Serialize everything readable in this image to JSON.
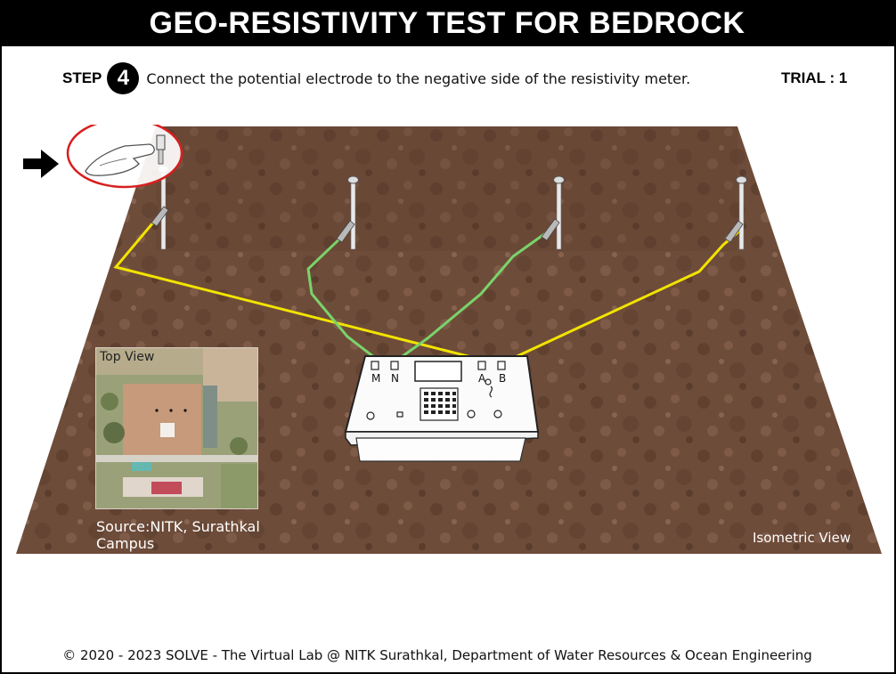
{
  "header": {
    "title": "GEO-RESISTIVITY TEST FOR BEDROCK"
  },
  "instruction": {
    "step_label": "STEP",
    "step_number": "4",
    "text": "Connect the potential electrode to the negative side of the resistivity meter."
  },
  "trial": {
    "label": "TRIAL : 1"
  },
  "meter": {
    "terminal_m": "M",
    "terminal_n": "N",
    "terminal_a": "A",
    "terminal_b": "B"
  },
  "top_view": {
    "label": "Top View"
  },
  "source": {
    "text": "Source:NITK, Surathkal Campus"
  },
  "view_label": {
    "text": "Isometric View"
  },
  "footer": {
    "text": "© 2020 - 2023 SOLVE - The Virtual Lab @ NITK Surathkal, Department of Water Resources & Ocean Engineering"
  },
  "colors": {
    "soil": "#6b4a38",
    "current_wire": "#f2e400",
    "potential_wire": "#7ad36a",
    "highlight": "#d91e1e"
  },
  "icons": [
    "arrow-right-icon",
    "hammer-hand-icon"
  ]
}
